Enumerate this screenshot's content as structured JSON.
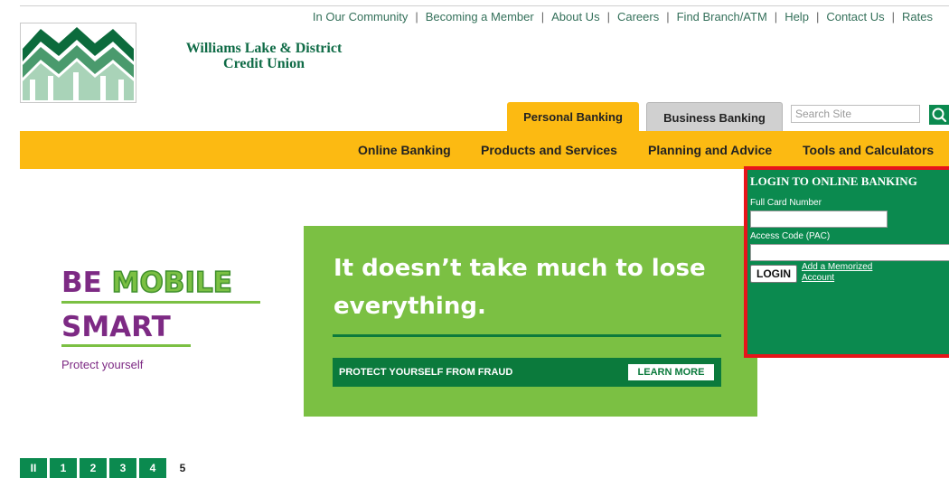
{
  "util_nav": [
    "In Our Community",
    "Becoming a Member",
    "About Us",
    "Careers",
    "Find Branch/ATM",
    "Help",
    "Contact Us",
    "Rates"
  ],
  "brand": {
    "line1": "Williams Lake & District",
    "line2": "Credit Union"
  },
  "tabs": {
    "personal": "Personal Banking",
    "business": "Business Banking"
  },
  "search": {
    "placeholder": "Search Site",
    "icon": "search-icon"
  },
  "main_nav": [
    "Online Banking",
    "Products and Services",
    "Planning and Advice",
    "Tools and Calculators"
  ],
  "hero_left": {
    "be": "BE",
    "mobile": "MOBILE",
    "smart": "SMART",
    "subtitle": "Protect yourself"
  },
  "banner": {
    "headline": "It doesn’t take much to lose everything.",
    "bar_text": "PROTECT YOURSELF FROM FRAUD",
    "cta": "LEARN MORE"
  },
  "carousel": {
    "pause": "II",
    "slides": [
      "1",
      "2",
      "3",
      "4",
      "5"
    ],
    "active": "5"
  },
  "login": {
    "title": "LOGIN TO ONLINE BANKING",
    "card_label": "Full Card Number",
    "pac_label": "Access Code (PAC)",
    "button": "LOGIN",
    "link_line1": "Add a Memorized",
    "link_line2": "Account"
  },
  "colors": {
    "brand_green": "#0b8a4f",
    "nav_yellow": "#fcba12",
    "banner_green": "#7bc043",
    "purple": "#7d2a84",
    "login_border": "#e8141a"
  }
}
